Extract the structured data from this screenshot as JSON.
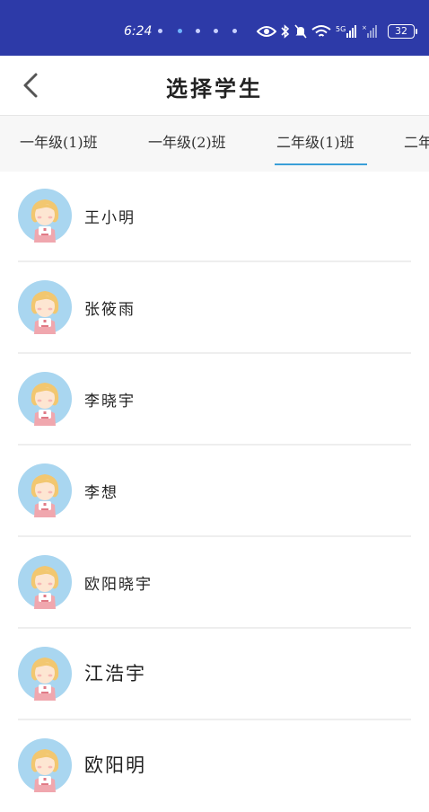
{
  "status_bar": {
    "time": "6:24",
    "battery": "32",
    "icons": [
      "notification-dot-icon",
      "eye-icon",
      "bluetooth-icon",
      "mute-icon",
      "wifi-icon",
      "signal-5g-icon",
      "signal-icon",
      "battery-icon"
    ],
    "background": "#2d3aa8"
  },
  "header": {
    "back_icon": "chevron-left-icon",
    "title": "选择学生"
  },
  "tabs": [
    {
      "label": "一年级(1)班",
      "active": false
    },
    {
      "label": "一年级(2)班",
      "active": false
    },
    {
      "label": "二年级(1)班",
      "active": true
    },
    {
      "label": "二年",
      "active": false
    }
  ],
  "accent_color": "#3a9fd8",
  "students": [
    {
      "name": "王小明"
    },
    {
      "name": "张筱雨"
    },
    {
      "name": "李晓宇"
    },
    {
      "name": "李想"
    },
    {
      "name": "欧阳晓宇"
    },
    {
      "name": "江浩宇"
    },
    {
      "name": "欧阳明"
    }
  ]
}
